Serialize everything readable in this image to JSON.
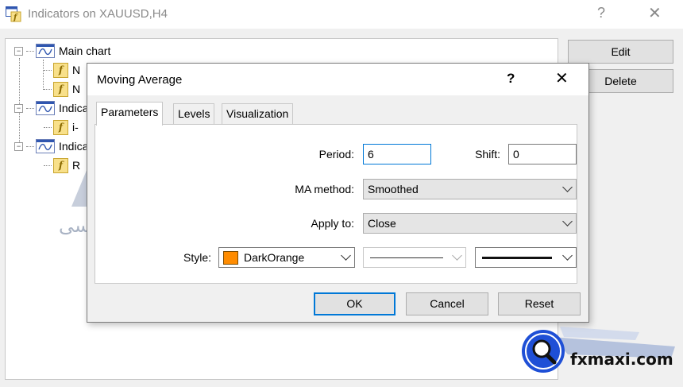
{
  "window": {
    "title": "Indicators on XAUUSD,H4",
    "help": "?",
    "close": "✕"
  },
  "tree": {
    "items": [
      {
        "label": "Main chart",
        "type": "chart"
      },
      {
        "label": "N",
        "type": "indicator"
      },
      {
        "label": "N",
        "type": "indicator"
      },
      {
        "label": "Indica",
        "type": "chart"
      },
      {
        "label": "i-",
        "type": "indicator"
      },
      {
        "label": "Indica",
        "type": "chart"
      },
      {
        "label": "R",
        "type": "indicator"
      }
    ]
  },
  "buttons": {
    "edit": "Edit",
    "delete": "Delete"
  },
  "watermark": {
    "text": "اف ایکس ماکسی"
  },
  "dialog": {
    "title": "Moving Average",
    "help": "?",
    "close": "✕",
    "tabs": [
      "Parameters",
      "Levels",
      "Visualization"
    ],
    "period": {
      "label": "Period:",
      "value": "6"
    },
    "shift": {
      "label": "Shift:",
      "value": "0"
    },
    "ma_method": {
      "label": "MA method:",
      "value": "Smoothed"
    },
    "apply_to": {
      "label": "Apply to:",
      "value": "Close"
    },
    "style": {
      "label": "Style:",
      "color_name": "DarkOrange",
      "color": "#ff8c00"
    },
    "ok": "OK",
    "cancel": "Cancel",
    "reset": "Reset"
  },
  "logo": {
    "text": "fxmaxi.com"
  },
  "colors": {
    "accent": "#0078d7",
    "tree_icon": "#2f56b0",
    "watermark": "#a9b3c4"
  }
}
